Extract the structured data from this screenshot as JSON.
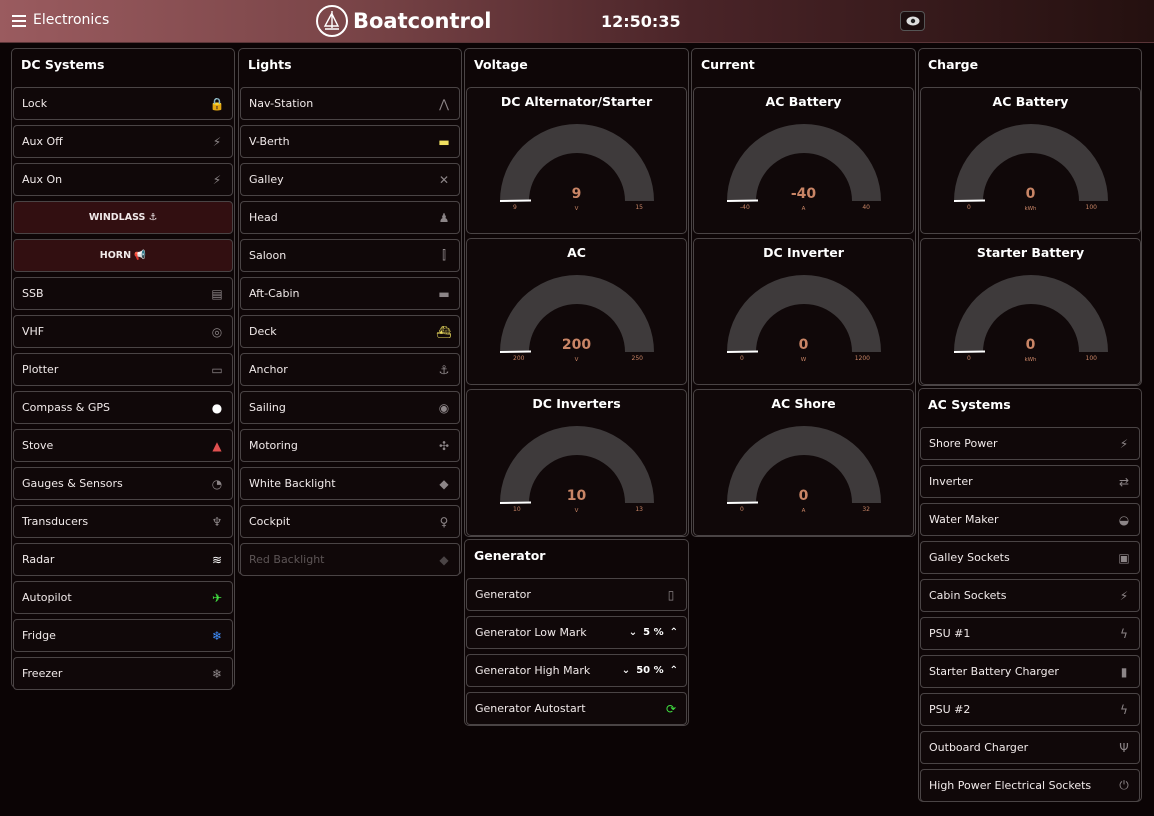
{
  "header": {
    "title": "Electronics",
    "brand": "Boatcontrol",
    "clock": "12:50:35"
  },
  "dc_systems": {
    "title": "DC Systems",
    "items": [
      {
        "label": "Lock",
        "icon": "lock-icon",
        "color": "#a040e0"
      },
      {
        "label": "Aux Off",
        "icon": "plug-icon"
      },
      {
        "label": "Aux On",
        "icon": "plug-icon"
      },
      {
        "label": "WINDLASS ⚓",
        "red": true
      },
      {
        "label": "HORN 📢",
        "red": true
      },
      {
        "label": "SSB",
        "icon": "radio-icon"
      },
      {
        "label": "VHF",
        "icon": "antenna-icon"
      },
      {
        "label": "Plotter",
        "icon": "laptop-icon"
      },
      {
        "label": "Compass & GPS",
        "icon": "globe-icon",
        "color": "#ffffff"
      },
      {
        "label": "Stove",
        "icon": "fire-icon",
        "color": "#e05050"
      },
      {
        "label": "Gauges & Sensors",
        "icon": "gauge-icon"
      },
      {
        "label": "Transducers",
        "icon": "signal-icon"
      },
      {
        "label": "Radar",
        "icon": "wifi-icon",
        "color": "#ffffff"
      },
      {
        "label": "Autopilot",
        "icon": "plane-icon",
        "color": "#40e040"
      },
      {
        "label": "Fridge",
        "icon": "snowflake-icon",
        "color": "#4090ff"
      },
      {
        "label": "Freezer",
        "icon": "snowflake-icon"
      }
    ]
  },
  "lights": {
    "title": "Lights",
    "items": [
      {
        "label": "Nav-Station",
        "icon": "compass-drawing-icon"
      },
      {
        "label": "V-Berth",
        "icon": "bed-icon",
        "color": "#f0e060"
      },
      {
        "label": "Galley",
        "icon": "utensils-icon"
      },
      {
        "label": "Head",
        "icon": "restroom-icon"
      },
      {
        "label": "Saloon",
        "icon": "fork-knife-icon"
      },
      {
        "label": "Aft-Cabin",
        "icon": "bed-icon"
      },
      {
        "label": "Deck",
        "icon": "ship-icon",
        "color": "#f0e060"
      },
      {
        "label": "Anchor",
        "icon": "anchor-icon"
      },
      {
        "label": "Sailing",
        "icon": "pin-icon"
      },
      {
        "label": "Motoring",
        "icon": "fan-icon"
      },
      {
        "label": "White Backlight",
        "icon": "lamp-icon"
      },
      {
        "label": "Cockpit",
        "icon": "person-icon"
      },
      {
        "label": "Red Backlight",
        "icon": "lamp-icon",
        "disabled": true
      }
    ]
  },
  "voltage": {
    "title": "Voltage",
    "gauges": [
      {
        "title": "DC Alternator/Starter",
        "value": "9",
        "unit": "V",
        "min": "9",
        "max": "15",
        "fraction": 0
      },
      {
        "title": "AC",
        "value": "200",
        "unit": "V",
        "min": "200",
        "max": "250",
        "fraction": 0
      },
      {
        "title": "DC Inverters",
        "value": "10",
        "unit": "V",
        "min": "10",
        "max": "13",
        "fraction": 0
      }
    ]
  },
  "current": {
    "title": "Current",
    "gauges": [
      {
        "title": "AC Battery",
        "value": "-40",
        "unit": "A",
        "min": "-40",
        "max": "40",
        "fraction": 0
      },
      {
        "title": "DC Inverter",
        "value": "0",
        "unit": "W",
        "min": "0",
        "max": "1200",
        "fraction": 0
      },
      {
        "title": "AC Shore",
        "value": "0",
        "unit": "A",
        "min": "0",
        "max": "32",
        "fraction": 0
      }
    ]
  },
  "charge": {
    "title": "Charge",
    "gauges": [
      {
        "title": "AC Battery",
        "value": "0",
        "unit": "kWh",
        "min": "0",
        "max": "100",
        "fraction": 0
      },
      {
        "title": "Starter Battery",
        "value": "0",
        "unit": "kWh",
        "min": "0",
        "max": "100",
        "fraction": 0
      }
    ]
  },
  "generator": {
    "title": "Generator",
    "items": [
      {
        "label": "Generator",
        "icon": "phone-icon"
      },
      {
        "label": "Generator Low Mark",
        "stepper": "5 %"
      },
      {
        "label": "Generator High Mark",
        "stepper": "50 %"
      },
      {
        "label": "Generator Autostart",
        "icon": "sync-icon",
        "color": "#40e040"
      }
    ]
  },
  "ac_systems": {
    "title": "AC Systems",
    "items": [
      {
        "label": "Shore Power",
        "icon": "plug-icon"
      },
      {
        "label": "Inverter",
        "icon": "shuffle-icon"
      },
      {
        "label": "Water Maker",
        "icon": "drop-icon"
      },
      {
        "label": "Galley Sockets",
        "icon": "socket-icon"
      },
      {
        "label": "Cabin Sockets",
        "icon": "plug-icon"
      },
      {
        "label": "PSU #1",
        "icon": "bolt-icon"
      },
      {
        "label": "Starter Battery Charger",
        "icon": "battery-icon"
      },
      {
        "label": "PSU #2",
        "icon": "bolt-icon"
      },
      {
        "label": "Outboard Charger",
        "icon": "fork-icon"
      },
      {
        "label": "High Power Electrical Sockets",
        "icon": "power-icon"
      }
    ]
  }
}
